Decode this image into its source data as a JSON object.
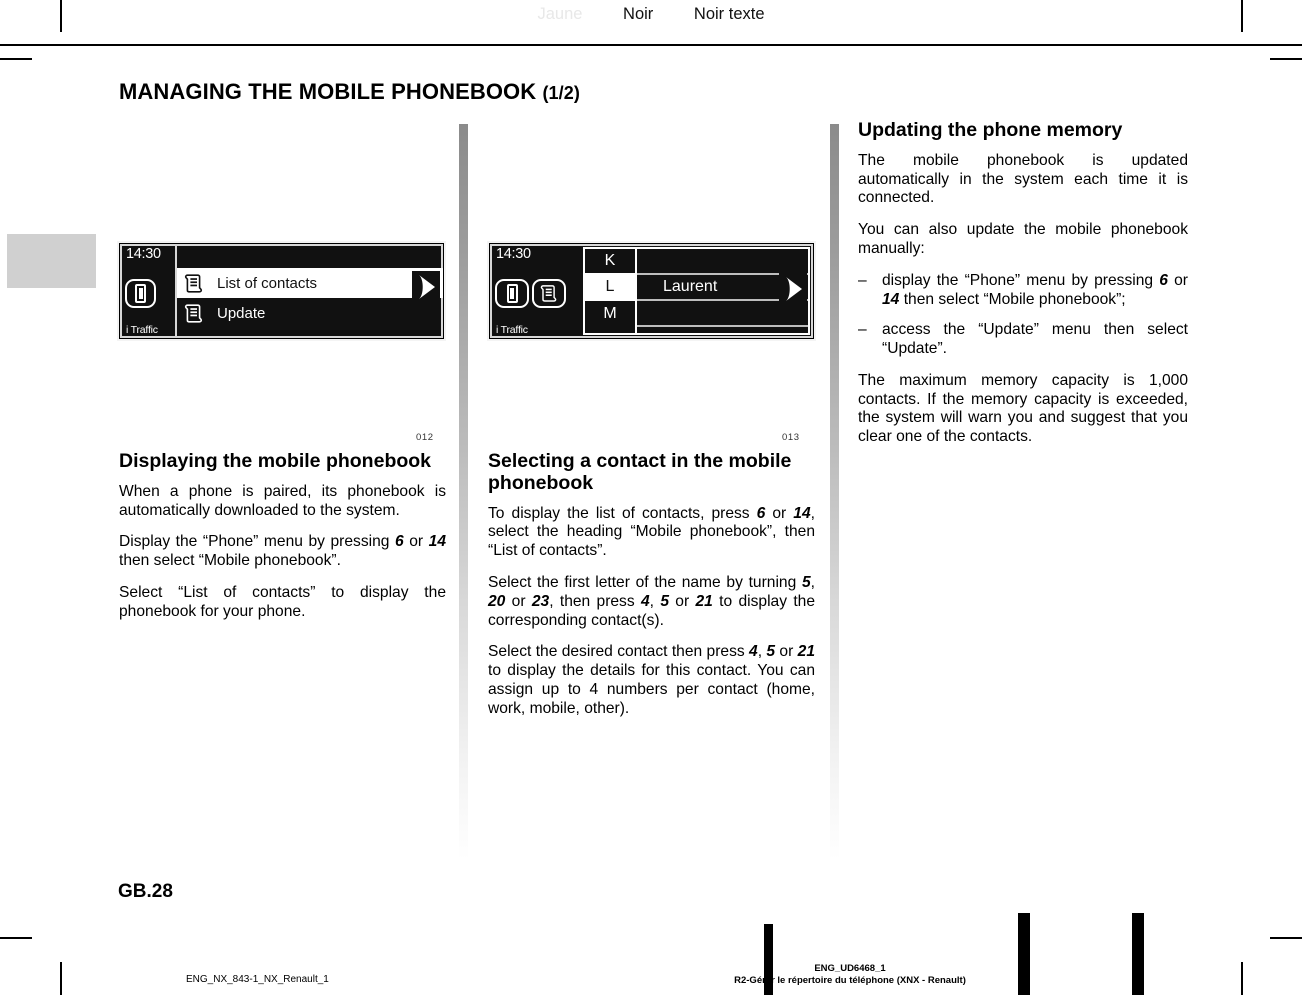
{
  "header": {
    "labels": [
      {
        "text": "Jaune",
        "tone": "light"
      },
      {
        "text": "Noir",
        "tone": "dark"
      },
      {
        "text": "Noir texte",
        "tone": "dark"
      }
    ]
  },
  "title": {
    "main": "MANAGING THE MOBILE PHONEBOOK ",
    "part": "(1/2)"
  },
  "figures": {
    "fig1_number": "012",
    "fig2_number": "013"
  },
  "device1": {
    "clock": "14:30",
    "traffic": "i Traffic",
    "rows": [
      {
        "label": "List of contacts",
        "selected": true
      },
      {
        "label": "Update",
        "selected": false
      }
    ],
    "arrow_icon": "play-arrow-icon",
    "phone_icon": "phone-tab-icon",
    "list_icon": "contact-list-icon"
  },
  "device2": {
    "clock": "14:30",
    "traffic": "i Traffic",
    "letters": [
      {
        "letter": "K",
        "selected": false,
        "name": ""
      },
      {
        "letter": "L",
        "selected": true,
        "name": "Laurent"
      },
      {
        "letter": "M",
        "selected": false,
        "name": ""
      }
    ],
    "arrow_icon": "play-arrow-icon"
  },
  "column1": {
    "heading": "Displaying the mobile phonebook",
    "paragraphs": [
      {
        "parts": [
          {
            "t": "When a phone is paired, its phonebook is automatically downloaded to the system.",
            "b": false
          }
        ]
      },
      {
        "parts": [
          {
            "t": "Display the “Phone” menu by pressing ",
            "b": false
          },
          {
            "t": "6",
            "b": true
          },
          {
            "t": " or ",
            "b": false
          },
          {
            "t": "14",
            "b": true
          },
          {
            "t": "  then select “Mobile phonebook”.",
            "b": false
          }
        ]
      },
      {
        "parts": [
          {
            "t": "Select “List of contacts” to display the phonebook for your phone.",
            "b": false
          }
        ]
      }
    ]
  },
  "column2": {
    "heading": "Selecting a contact in the mobile phonebook",
    "paragraphs": [
      {
        "parts": [
          {
            "t": "To display the list of contacts, press ",
            "b": false
          },
          {
            "t": "6",
            "b": true
          },
          {
            "t": " or ",
            "b": false
          },
          {
            "t": "14",
            "b": true
          },
          {
            "t": ", select the heading “Mobile phonebook”, then “List of contacts”.",
            "b": false
          }
        ]
      },
      {
        "parts": [
          {
            "t": "Select the first letter of the name by turning ",
            "b": false
          },
          {
            "t": "5",
            "b": true
          },
          {
            "t": ", ",
            "b": false
          },
          {
            "t": "20",
            "b": true
          },
          {
            "t": "  or ",
            "b": false
          },
          {
            "t": "23",
            "b": true
          },
          {
            "t": ", then press ",
            "b": false
          },
          {
            "t": "4",
            "b": true
          },
          {
            "t": ", ",
            "b": false
          },
          {
            "t": "5",
            "b": true
          },
          {
            "t": " or ",
            "b": false
          },
          {
            "t": "21",
            "b": true
          },
          {
            "t": "  to display the corresponding contact(s).",
            "b": false
          }
        ]
      },
      {
        "parts": [
          {
            "t": "Select the desired contact then press ",
            "b": false
          },
          {
            "t": "4",
            "b": true
          },
          {
            "t": ", ",
            "b": false
          },
          {
            "t": "5",
            "b": true
          },
          {
            "t": "  or ",
            "b": false
          },
          {
            "t": "21",
            "b": true
          },
          {
            "t": " to display the details for this contact. You can assign up to 4 numbers per contact  (home, work, mobile, other).",
            "b": false
          }
        ]
      }
    ]
  },
  "column3": {
    "heading": "Updating the phone memory",
    "intro": [
      {
        "parts": [
          {
            "t": "The mobile phonebook is updated automatically in the system each time it is connected.",
            "b": false
          }
        ]
      },
      {
        "parts": [
          {
            "t": "You can also update the mobile phonebook manually:",
            "b": false
          }
        ]
      }
    ],
    "bullets": [
      {
        "dash": "–",
        "parts": [
          {
            "t": "display the “Phone” menu by pressing ",
            "b": false
          },
          {
            "t": "6",
            "b": true
          },
          {
            "t": "  or ",
            "b": false
          },
          {
            "t": "14",
            "b": true
          },
          {
            "t": "   then select “Mobile phonebook”;",
            "b": false
          }
        ]
      },
      {
        "dash": "–",
        "parts": [
          {
            "t": "access the “Update” menu then select “Update”.",
            "b": false
          }
        ]
      }
    ],
    "outro": [
      {
        "parts": [
          {
            "t": "The maximum memory capacity is 1,000 contacts. If the memory capacity is exceeded, the system will warn you and suggest that you clear one of the contacts.",
            "b": false
          }
        ]
      }
    ]
  },
  "page_number": "GB.28",
  "footer": {
    "left_code": "ENG_NX_843-1_NX_Renault_1",
    "right_code": "ENG_UD6468_1",
    "right_title": "R2-Gérer le répertoire du téléphone (XNX - Renault)"
  }
}
